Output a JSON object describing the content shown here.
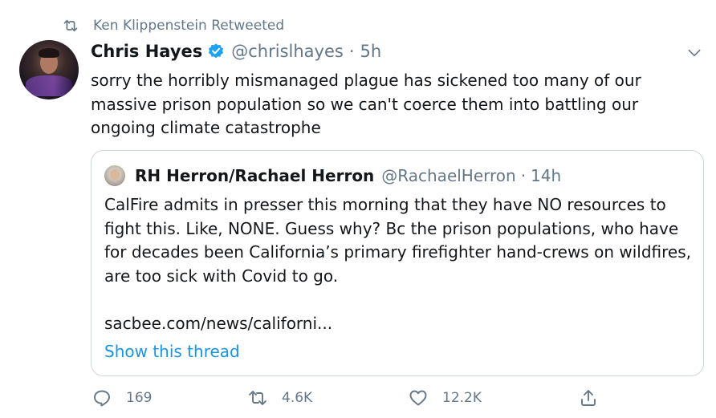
{
  "retweet_context": {
    "text": "Ken Klippenstein Retweeted",
    "icon": "retweet-icon"
  },
  "tweet": {
    "author_name": "Chris Hayes",
    "verified": true,
    "handle": "@chrislhayes",
    "separator": "·",
    "time": "5h",
    "text": "sorry the horribly mismanaged plague has sickened too many of our\nmassive prison population so we can't coerce them into battling our\nongoing climate catastrophe"
  },
  "quoted_tweet": {
    "author_name": "RH Herron/Rachael Herron",
    "handle": "@RachaelHerron",
    "separator": "·",
    "time": "14h",
    "text": "CalFire admits in presser this morning that they have NO resources to fight this. Like, NONE. Guess why? Bc the prison populations, who have for decades been California’s primary firefighter hand-crews on wildfires, are too sick with Covid to go.",
    "link": "sacbee.com/news/californi...",
    "show_thread": "Show this thread"
  },
  "actions": {
    "reply_count": "169",
    "retweet_count": "4.6K",
    "like_count": "12.2K"
  },
  "colors": {
    "text": "#14171a",
    "secondary": "#657786",
    "link": "#1b95e0",
    "verified": "#1da1f2",
    "border": "#ccd6dd"
  }
}
